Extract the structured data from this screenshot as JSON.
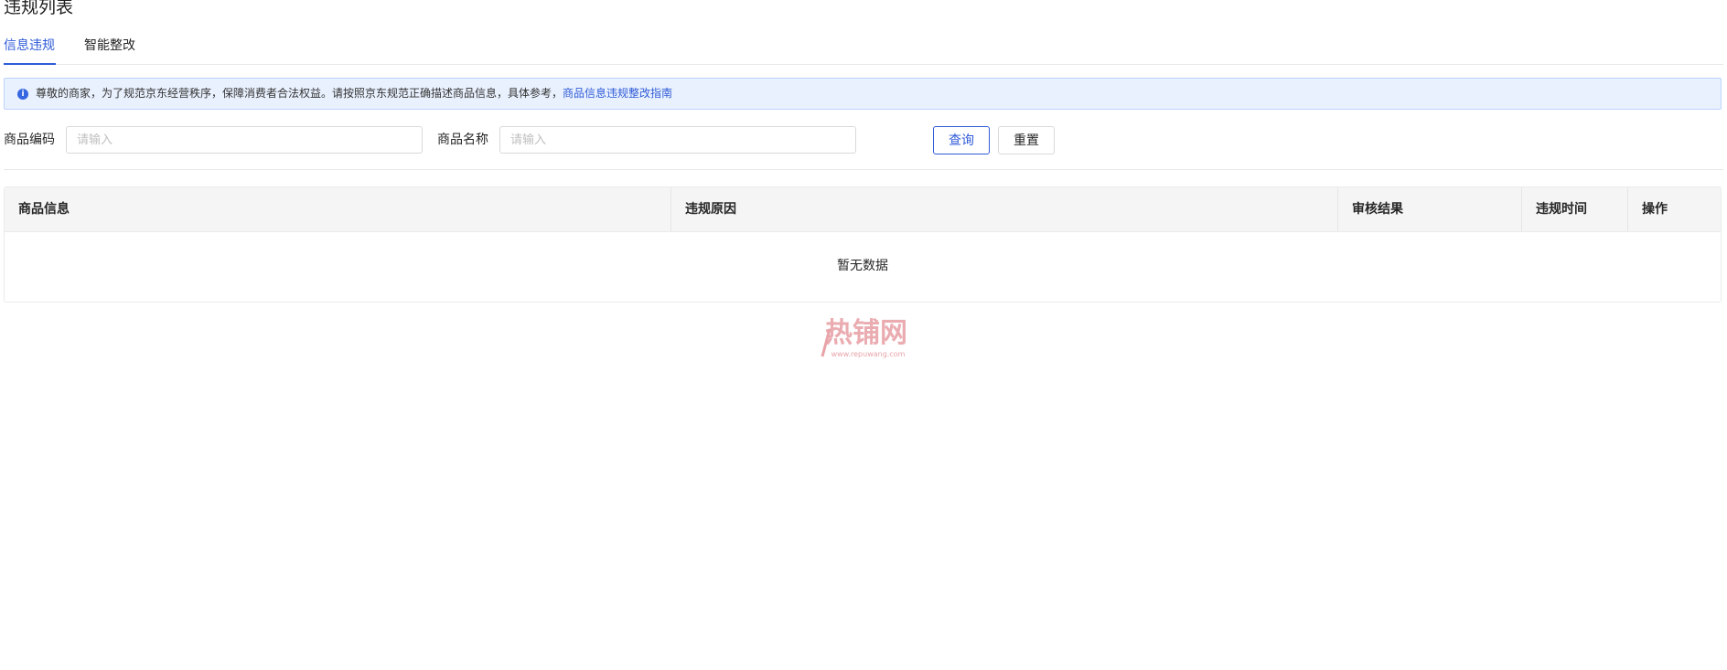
{
  "page": {
    "title": "违规列表"
  },
  "tabs": [
    {
      "label": "信息违规",
      "active": true
    },
    {
      "label": "智能整改",
      "active": false
    }
  ],
  "notice": {
    "icon": "info-icon",
    "text": "尊敬的商家，为了规范京东经营秩序，保障消费者合法权益。请按照京东规范正确描述商品信息，具体参考，",
    "link_text": "商品信息违规整改指南"
  },
  "filters": {
    "code_label": "商品编码",
    "code_placeholder": "请输入",
    "code_value": "",
    "name_label": "商品名称",
    "name_placeholder": "请输入",
    "name_value": "",
    "query_label": "查询",
    "reset_label": "重置"
  },
  "table": {
    "columns": [
      "商品信息",
      "违规原因",
      "审核结果",
      "违规时间",
      "操作"
    ],
    "empty_text": "暂无数据"
  },
  "watermark": {
    "brand": "热铺网",
    "url": "www.repuwang.com"
  },
  "colors": {
    "primary": "#2f5bd8",
    "notice_bg": "#e9f1fe",
    "watermark": "#e8a3a8"
  }
}
